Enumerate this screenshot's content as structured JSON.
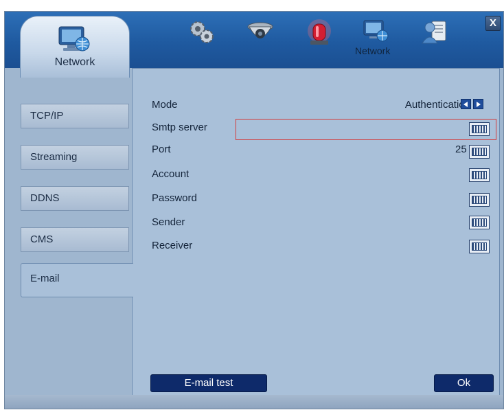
{
  "header": {
    "active_tab_label": "Network",
    "top_icons": [
      "gears-icon",
      "camera-icon",
      "alarm-icon",
      "network-icon",
      "user-icon"
    ],
    "network_caption": "Network",
    "close_label": "X"
  },
  "sidebar": {
    "items": [
      {
        "label": "TCP/IP"
      },
      {
        "label": "Streaming"
      },
      {
        "label": "DDNS"
      },
      {
        "label": "CMS"
      },
      {
        "label": "E-mail"
      }
    ]
  },
  "form": {
    "mode_label": "Mode",
    "mode_value": "Authentication",
    "smtp_label": "Smtp server",
    "smtp_value": "",
    "port_label": "Port",
    "port_value": "25",
    "account_label": "Account",
    "password_label": "Password",
    "sender_label": "Sender",
    "receiver_label": "Receiver"
  },
  "buttons": {
    "email_test": "E-mail test",
    "ok": "Ok"
  },
  "colors": {
    "header_blue": "#1f5aa0",
    "panel_bg": "#a9c0d9",
    "highlight_red": "#d33a3a",
    "button_navy": "#0e2a6a"
  }
}
